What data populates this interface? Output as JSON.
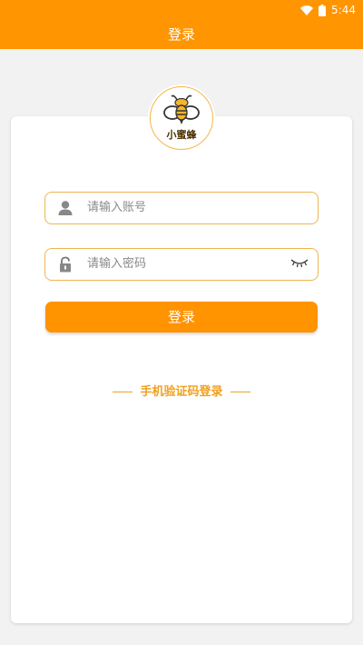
{
  "status": {
    "time": "5:44"
  },
  "header": {
    "title": "登录"
  },
  "logo": {
    "text": "小蜜蜂"
  },
  "form": {
    "account_placeholder": "请输入账号",
    "password_placeholder": "请输入密码",
    "login_label": "登录"
  },
  "alt_login": {
    "label": "手机验证码登录"
  },
  "colors": {
    "accent": "#ff9500",
    "border": "#f0b450",
    "link": "#f0a020"
  },
  "icons": [
    "wifi-icon",
    "battery-icon",
    "bee-logo",
    "user-icon",
    "lock-icon",
    "eye-closed-icon"
  ]
}
